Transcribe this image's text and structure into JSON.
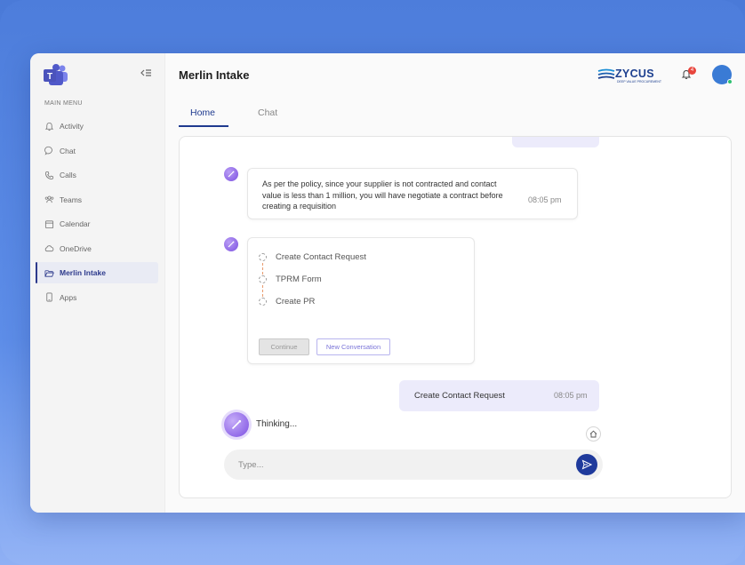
{
  "sidebar": {
    "menu_title": "MAIN MENU",
    "items": [
      {
        "label": "Activity",
        "icon": "bell-icon"
      },
      {
        "label": "Chat",
        "icon": "chat-bubble-icon"
      },
      {
        "label": "Calls",
        "icon": "phone-icon"
      },
      {
        "label": "Teams",
        "icon": "people-icon"
      },
      {
        "label": "Calendar",
        "icon": "calendar-icon"
      },
      {
        "label": "OneDrive",
        "icon": "cloud-icon"
      },
      {
        "label": "Merlin Intake",
        "icon": "folder-open-icon",
        "active": true
      },
      {
        "label": "Apps",
        "icon": "device-icon"
      }
    ]
  },
  "header": {
    "title": "Merlin Intake",
    "brand_name": "ZYCUS",
    "brand_tagline": "DEEP VALUE PROCUREMENT",
    "notification_count": "4"
  },
  "tabs": [
    {
      "label": "Home",
      "active": true
    },
    {
      "label": "Chat",
      "active": false
    }
  ],
  "chat": {
    "policy_message": {
      "text": "As per the policy, since your supplier is not contracted and contact value is less than 1 million, you will have negotiate a contract before creating a requisition",
      "time": "08:05 pm"
    },
    "steps": [
      "Create Contact Request",
      "TPRM Form",
      "Create PR"
    ],
    "continue_label": "Continue",
    "new_conversation_label": "New Conversation",
    "user_message": {
      "text": "Create Contact Request",
      "time": "08:05 pm"
    },
    "thinking_text": "Thinking...",
    "input_placeholder": "Type..."
  },
  "colors": {
    "accent": "#1f3a8f",
    "bot_purple": "#7b4fe0",
    "user_bubble": "#ecebfb",
    "background_blue": "#4d7ddb"
  }
}
